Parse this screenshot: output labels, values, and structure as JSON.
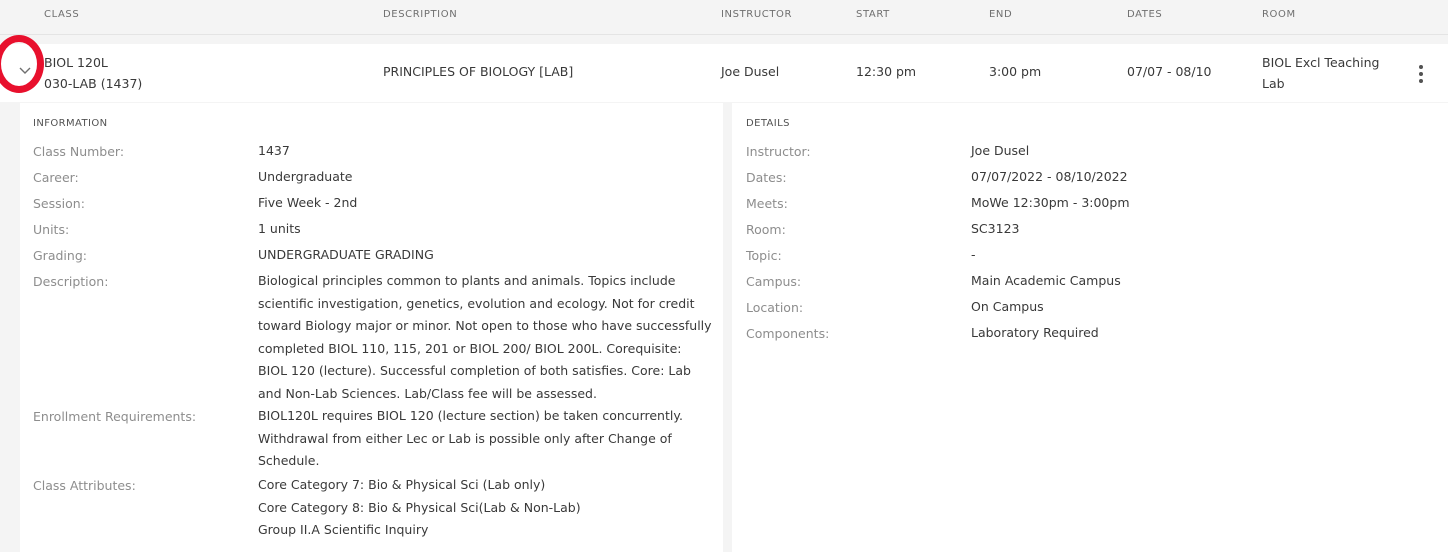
{
  "columns": {
    "class": "CLASS",
    "description": "DESCRIPTION",
    "instructor": "INSTRUCTOR",
    "start": "START",
    "end": "END",
    "dates": "DATES",
    "room": "ROOM"
  },
  "class_row": {
    "class_line1": "BIOL 120L",
    "class_line2": "030-LAB (1437)",
    "description": "PRINCIPLES OF BIOLOGY [LAB]",
    "instructor": "Joe Dusel",
    "start": "12:30 pm",
    "end": "3:00 pm",
    "dates": "07/07 - 08/10",
    "room_line1": "BIOL Excl Teaching",
    "room_line2": "Lab",
    "expand_icon": "chevron-down-icon",
    "menu_icon": "overflow-menu-vertical-icon"
  },
  "information": {
    "title": "INFORMATION",
    "class_number_label": "Class Number:",
    "class_number": "1437",
    "career_label": "Career:",
    "career": "Undergraduate",
    "session_label": "Session:",
    "session": "Five Week - 2nd",
    "units_label": "Units:",
    "units": "1 units",
    "grading_label": "Grading:",
    "grading": "UNDERGRADUATE GRADING",
    "description_label": "Description:",
    "description_lines": [
      "Biological principles common to plants and animals. Topics include",
      "scientific investigation, genetics, evolution and ecology. Not for credit",
      "toward Biology major or minor. Not open to those who have successfully",
      "completed BIOL 110, 115, 201 or BIOL 200/ BIOL 200L. Corequisite:",
      "BIOL 120 (lecture). Successful completion of both satisfies. Core: Lab",
      "and Non-Lab Sciences. Lab/Class fee will be assessed."
    ],
    "enrollment_label": "Enrollment Requirements:",
    "enrollment_lines": [
      "BIOL120L requires BIOL 120 (lecture section) be taken concurrently.",
      "Withdrawal from either Lec or Lab is possible only after Change of",
      "Schedule."
    ],
    "attributes_label": "Class Attributes:",
    "attributes": [
      "Core Category 7: Bio & Physical Sci (Lab only)",
      "Core Category 8: Bio & Physical Sci(Lab & Non-Lab)",
      "Group II.A Scientific Inquiry"
    ]
  },
  "details": {
    "title": "DETAILS",
    "instructor_label": "Instructor:",
    "instructor": "Joe Dusel",
    "dates_label": "Dates:",
    "dates": "07/07/2022 - 08/10/2022",
    "meets_label": "Meets:",
    "meets": "MoWe 12:30pm - 3:00pm",
    "room_label": "Room:",
    "room": "SC3123",
    "topic_label": "Topic:",
    "topic": "-",
    "campus_label": "Campus:",
    "campus": "Main Academic Campus",
    "location_label": "Location:",
    "location": "On Campus",
    "components_label": "Components:",
    "components": "Laboratory Required"
  },
  "colors": {
    "annotation_ring": "#e8102d",
    "page_background": "#f4f4f4",
    "panel_background": "#ffffff"
  }
}
